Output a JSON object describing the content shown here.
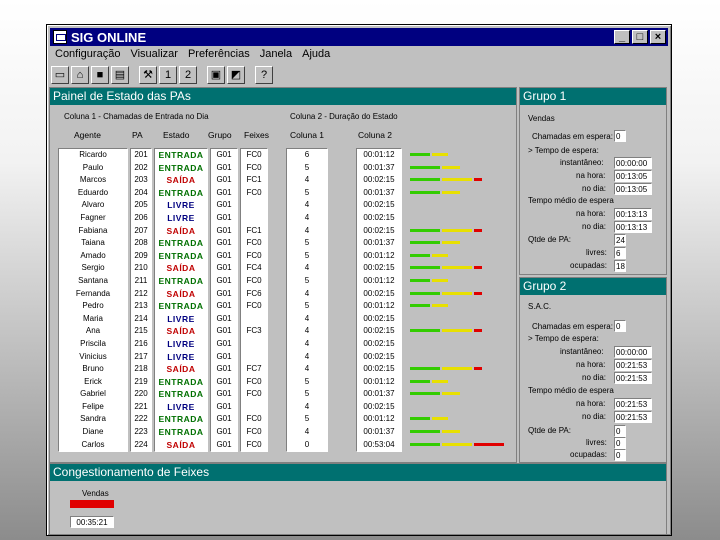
{
  "app": {
    "title": "SIG ONLINE",
    "btn_min": "_",
    "btn_max": "□",
    "btn_close": "×"
  },
  "menu": [
    "Configuração",
    "Visualizar",
    "Preferências",
    "Janela",
    "Ajuda"
  ],
  "toolbar": [
    "new-doc",
    "open-folder",
    "save-disk",
    "print",
    "tool",
    "1",
    "2",
    "window",
    "tile",
    "help"
  ],
  "main": {
    "title": "Painel de Estado das PAs",
    "col1": "Coluna 1 - Chamadas de Entrada no Dia",
    "col2": "Coluna 2 - Duração do Estado",
    "h_agent": "Agente",
    "h_pa": "PA",
    "h_state": "Estado",
    "h_group": "Grupo",
    "h_queue": "Feixes",
    "h_col1": "Coluna 1",
    "h_col2": "Coluna 2"
  },
  "rows": [
    [
      "Ricardo",
      "201",
      "ENTRADA",
      "G01",
      "FC0",
      "6",
      "00:01:12",
      [
        20,
        16,
        0
      ]
    ],
    [
      "Paulo",
      "202",
      "ENTRADA",
      "G01",
      "FC0",
      "5",
      "00:01:37",
      [
        30,
        18,
        0
      ]
    ],
    [
      "Marcos",
      "203",
      "SAÍDA",
      "G01",
      "FC1",
      "4",
      "00:02:15",
      [
        30,
        30,
        8
      ]
    ],
    [
      "Eduardo",
      "204",
      "ENTRADA",
      "G01",
      "FC0",
      "5",
      "00:01:37",
      [
        30,
        18,
        0
      ]
    ],
    [
      "Alvaro",
      "205",
      "LIVRE",
      "G01",
      "",
      "4",
      "00:02:15",
      [
        0,
        0,
        0
      ]
    ],
    [
      "Fagner",
      "206",
      "LIVRE",
      "G01",
      "",
      "4",
      "00:02:15",
      [
        0,
        0,
        0
      ]
    ],
    [
      "Fabiana",
      "207",
      "SAÍDA",
      "G01",
      "FC1",
      "4",
      "00:02:15",
      [
        30,
        30,
        8
      ]
    ],
    [
      "Taiana",
      "208",
      "ENTRADA",
      "G01",
      "FC0",
      "5",
      "00:01:37",
      [
        30,
        18,
        0
      ]
    ],
    [
      "Amado",
      "209",
      "ENTRADA",
      "G01",
      "FC0",
      "5",
      "00:01:12",
      [
        20,
        16,
        0
      ]
    ],
    [
      "Sergio",
      "210",
      "SAÍDA",
      "G01",
      "FC4",
      "4",
      "00:02:15",
      [
        30,
        30,
        8
      ]
    ],
    [
      "Santana",
      "211",
      "ENTRADA",
      "G01",
      "FC0",
      "5",
      "00:01:12",
      [
        20,
        16,
        0
      ]
    ],
    [
      "Fernanda",
      "212",
      "SAÍDA",
      "G01",
      "FC6",
      "4",
      "00:02:15",
      [
        30,
        30,
        8
      ]
    ],
    [
      "Pedro",
      "213",
      "ENTRADA",
      "G01",
      "FC0",
      "5",
      "00:01:12",
      [
        20,
        16,
        0
      ]
    ],
    [
      "Maria",
      "214",
      "LIVRE",
      "G01",
      "",
      "4",
      "00:02:15",
      [
        0,
        0,
        0
      ]
    ],
    [
      "Ana",
      "215",
      "SAÍDA",
      "G01",
      "FC3",
      "4",
      "00:02:15",
      [
        30,
        30,
        8
      ]
    ],
    [
      "Priscila",
      "216",
      "LIVRE",
      "G01",
      "",
      "4",
      "00:02:15",
      [
        0,
        0,
        0
      ]
    ],
    [
      "Vinicius",
      "217",
      "LIVRE",
      "G01",
      "",
      "4",
      "00:02:15",
      [
        0,
        0,
        0
      ]
    ],
    [
      "Bruno",
      "218",
      "SAÍDA",
      "G01",
      "FC7",
      "4",
      "00:02:15",
      [
        30,
        30,
        8
      ]
    ],
    [
      "Erick",
      "219",
      "ENTRADA",
      "G01",
      "FC0",
      "5",
      "00:01:12",
      [
        20,
        16,
        0
      ]
    ],
    [
      "Gabriel",
      "220",
      "ENTRADA",
      "G01",
      "FC0",
      "5",
      "00:01:37",
      [
        30,
        18,
        0
      ]
    ],
    [
      "Felipe",
      "221",
      "LIVRE",
      "G01",
      "",
      "4",
      "00:02:15",
      [
        0,
        0,
        0
      ]
    ],
    [
      "Sandra",
      "222",
      "ENTRADA",
      "G01",
      "FC0",
      "5",
      "00:01:12",
      [
        20,
        16,
        0
      ]
    ],
    [
      "Diane",
      "223",
      "ENTRADA",
      "G01",
      "FC0",
      "4",
      "00:01:37",
      [
        30,
        18,
        0
      ]
    ],
    [
      "Carlos",
      "224",
      "SAÍDA",
      "G01",
      "FC0",
      "0",
      "00:53:04",
      [
        30,
        30,
        30
      ]
    ]
  ],
  "colors": {
    "ENTRADA": "#007000",
    "SAÍDA": "#c00000",
    "LIVRE": "#000080",
    "green": "#33cc00",
    "yellow": "#e8e000",
    "red": "#e00000"
  },
  "g1": {
    "title": "Grupo 1",
    "name": "Vendas",
    "l_wait": "Chamadas em espera:",
    "v_wait": "0",
    "l_tm": "> Tempo de espera:",
    "l_inst": "instantâneo:",
    "v_inst": "00:00:00",
    "l_hour": "na hora:",
    "v_hour": "00:13:05",
    "l_day": "no dia:",
    "v_day": "00:13:05",
    "l_avg": "Tempo médio de espera",
    "l_hour2": "na hora:",
    "v_hour2": "00:13:13",
    "l_day2": "no dia:",
    "v_day2": "00:13:13",
    "l_qty": "Qtde de PA:",
    "v_qty": "24",
    "l_free": "livres:",
    "v_free": "6",
    "l_busy": "ocupadas:",
    "v_busy": "18"
  },
  "g2": {
    "title": "Grupo 2",
    "name": "S.A.C.",
    "l_wait": "Chamadas em espera:",
    "v_wait": "0",
    "l_tm": "> Tempo de espera:",
    "l_inst": "instantâneo:",
    "v_inst": "00:00:00",
    "l_hour": "na hora:",
    "v_hour": "00:21:53",
    "l_day": "no dia:",
    "v_day": "00:21:53",
    "l_avg": "Tempo médio de espera",
    "l_hour2": "na hora:",
    "v_hour2": "00:21:53",
    "l_day2": "no dia:",
    "v_day2": "00:21:53",
    "l_qty": "Qtde de PA:",
    "v_qty": "0",
    "l_free": "livres:",
    "v_free": "0",
    "l_busy": "ocupadas:",
    "v_busy": "0"
  },
  "congest": {
    "title": "Congestionamento de Feixes",
    "label": "Vendas",
    "time": "00:35:21",
    "color": "#e00000"
  }
}
